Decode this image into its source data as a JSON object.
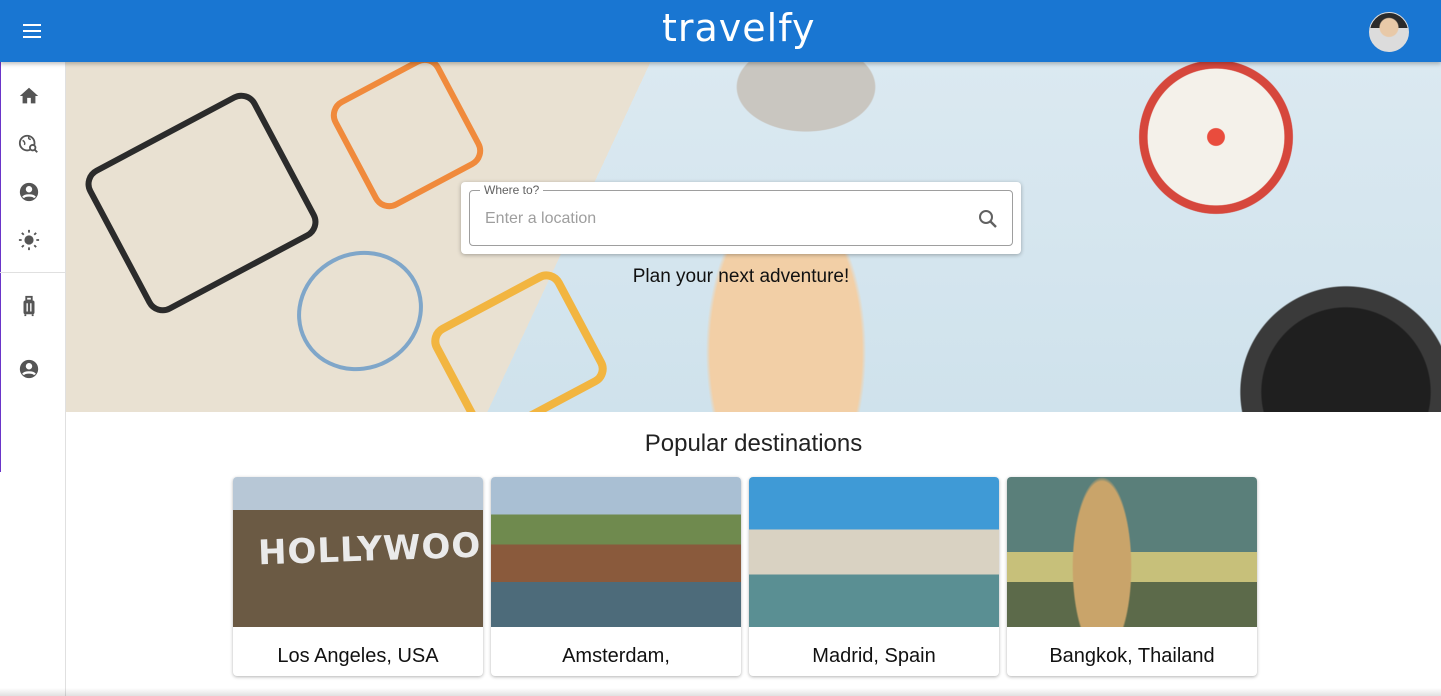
{
  "header": {
    "logo": "travelfy",
    "menu_icon": "menu-icon",
    "avatar_icon": "user-avatar"
  },
  "sidebar": {
    "items": [
      {
        "name": "home",
        "icon": "home-icon"
      },
      {
        "name": "explore",
        "icon": "travel-explore-icon"
      },
      {
        "name": "profile",
        "icon": "account-circle-icon"
      },
      {
        "name": "theme",
        "icon": "brightness-icon"
      },
      {
        "name": "trips",
        "icon": "luggage-icon"
      },
      {
        "name": "account",
        "icon": "account-circle-icon"
      }
    ]
  },
  "search": {
    "label": "Where to?",
    "placeholder": "Enter a location",
    "value": ""
  },
  "hero": {
    "tagline": "Plan your next adventure!"
  },
  "popular": {
    "title": "Popular destinations",
    "destinations": [
      {
        "name": "Los Angeles, USA",
        "image_text": "HOLLYWOOD"
      },
      {
        "name": "Amsterdam,"
      },
      {
        "name": "Madrid, Spain"
      },
      {
        "name": "Bangkok, Thailand"
      }
    ]
  },
  "colors": {
    "primary": "#1976d2",
    "sidebar_accent": "#6a35c9"
  }
}
